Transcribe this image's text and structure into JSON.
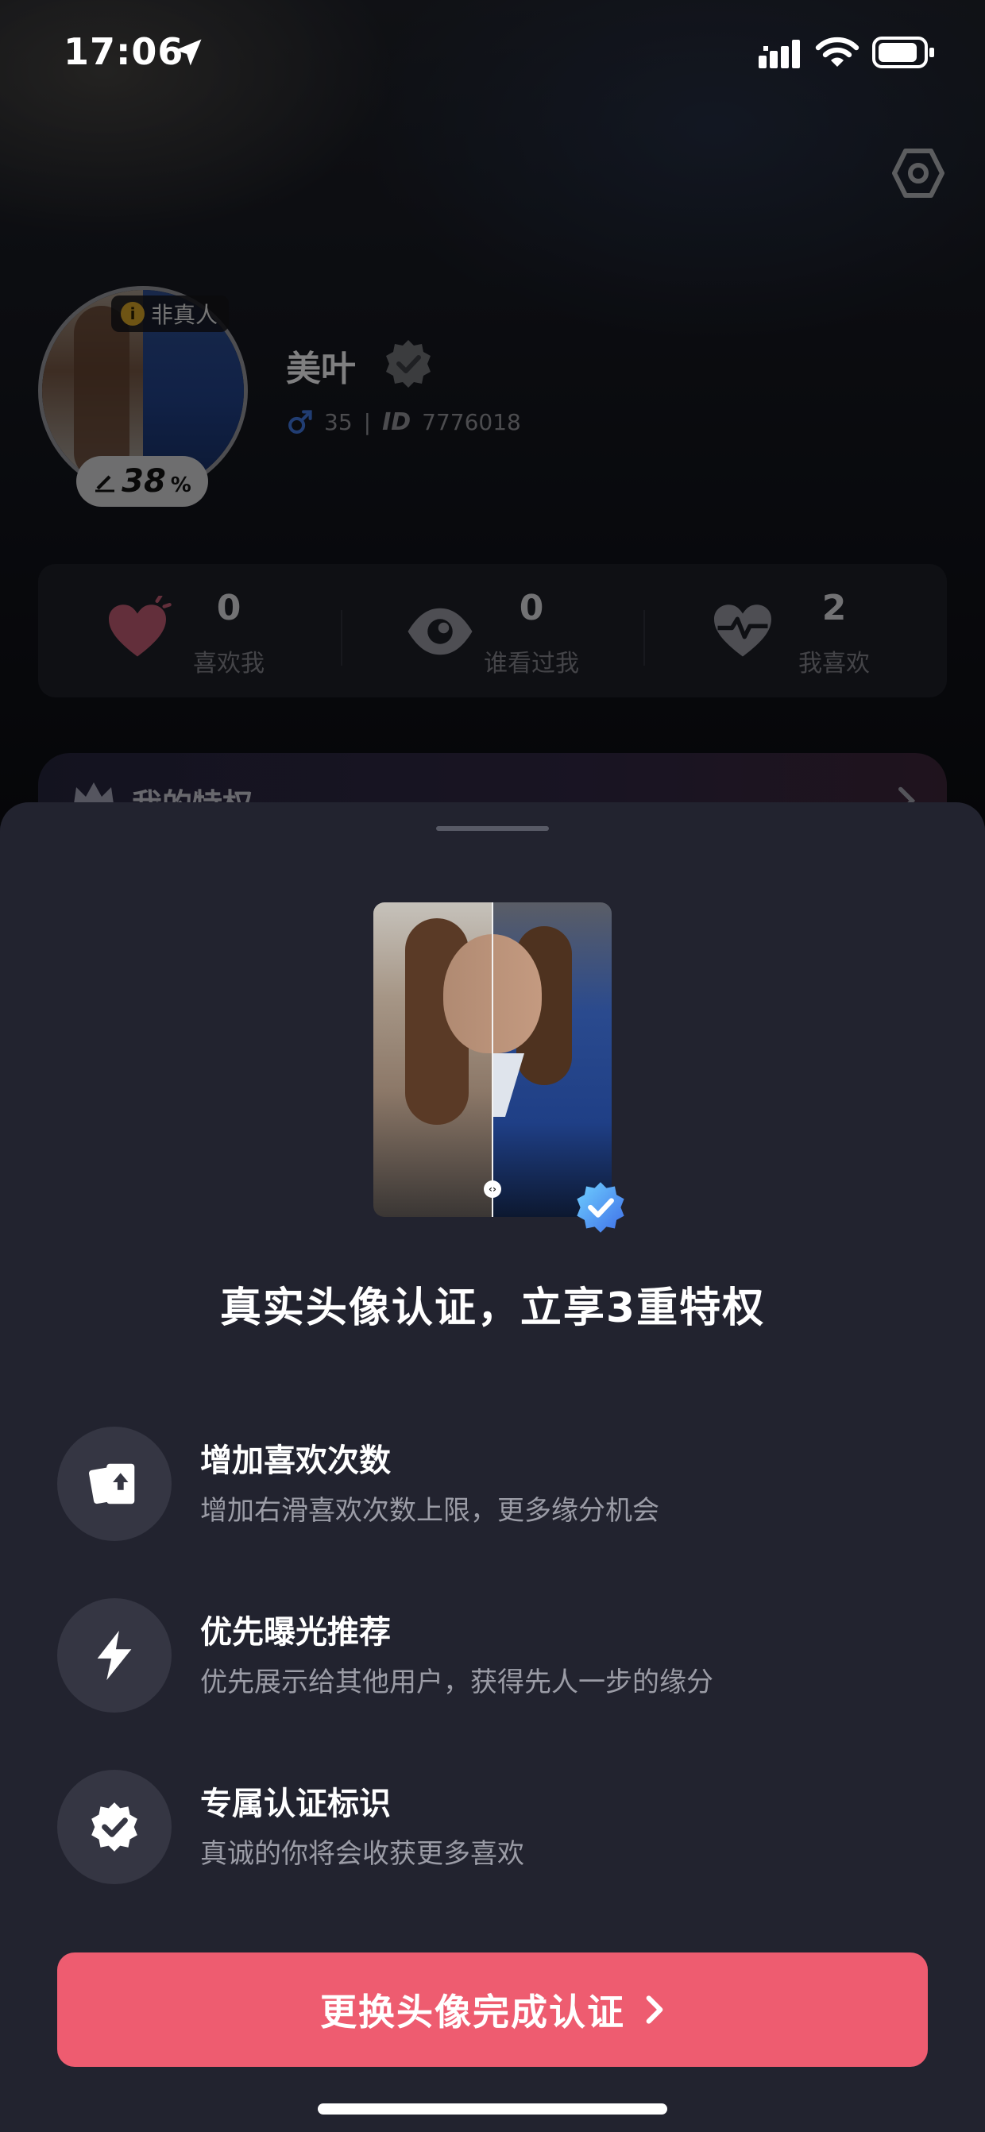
{
  "status_bar": {
    "time": "17:06"
  },
  "profile": {
    "name": "美叶",
    "badge_nonreal": "非真人",
    "badge_info": "i",
    "completion_value": "38",
    "completion_unit": "%",
    "age": "35",
    "separator": "|",
    "id_label": "ID",
    "user_id": "7776018"
  },
  "stats": [
    {
      "value": "0",
      "label": "喜欢我"
    },
    {
      "value": "0",
      "label": "谁看过我"
    },
    {
      "value": "2",
      "label": "我喜欢"
    }
  ],
  "privilege_bar": {
    "label": "我的特权"
  },
  "sheet": {
    "title": "真实头像认证，立享3重特权",
    "benefits": [
      {
        "title": "增加喜欢次数",
        "desc": "增加右滑喜欢次数上限，更多缘分机会",
        "icon": "cards-icon"
      },
      {
        "title": "优先曝光推荐",
        "desc": "优先展示给其他用户，获得先人一步的缘分",
        "icon": "lightning-icon"
      },
      {
        "title": "专属认证标识",
        "desc": "真诚的你将会收获更多喜欢",
        "icon": "verified-badge-icon"
      }
    ],
    "cta_label": "更换头像完成认证"
  },
  "colors": {
    "accent": "#ee5c70",
    "sheet_bg": "#22232f",
    "verified_blue": "#4aa8f0"
  }
}
